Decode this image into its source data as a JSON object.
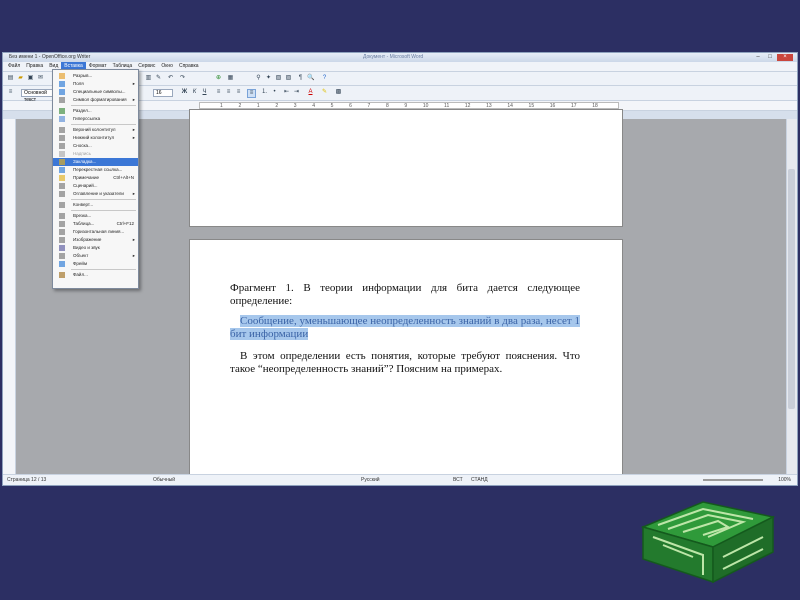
{
  "window": {
    "title": "Без имени 1 - OpenOffice.org Writer",
    "center_title": "Документ - Microsoft Word"
  },
  "menubar": [
    "Файл",
    "Правка",
    "Вид",
    "Вставка",
    "Формат",
    "Таблица",
    "Сервис",
    "Окно",
    "Справка"
  ],
  "format_bar": {
    "style_value": "Основной текст",
    "size_value": "16",
    "zoom_label": "100%"
  },
  "ruler": {
    "ticks": [
      "1",
      "2",
      "1",
      "2",
      "3",
      "4",
      "5",
      "6",
      "7",
      "8",
      "9",
      "10",
      "11",
      "12",
      "13",
      "14",
      "15",
      "16",
      "17",
      "18"
    ]
  },
  "insert_menu": {
    "items": [
      {
        "label": "Разрыв...",
        "type": "item"
      },
      {
        "label": "Поля",
        "type": "submenu"
      },
      {
        "label": "Специальные символы...",
        "type": "item"
      },
      {
        "label": "Символ форматирования",
        "type": "submenu"
      },
      {
        "type": "separator"
      },
      {
        "label": "Раздел...",
        "type": "item"
      },
      {
        "label": "Гиперссылка",
        "type": "item"
      },
      {
        "type": "separator"
      },
      {
        "label": "Верхний колонтитул",
        "type": "submenu"
      },
      {
        "label": "Нижний колонтитул",
        "type": "submenu"
      },
      {
        "label": "Сноска...",
        "type": "item"
      },
      {
        "label": "Надпись",
        "type": "disabled"
      },
      {
        "label": "Закладка...",
        "type": "selected"
      },
      {
        "label": "Перекрестная ссылка...",
        "type": "item"
      },
      {
        "label": "Примечание",
        "shortcut": "Ctrl+Alt+N",
        "type": "item"
      },
      {
        "label": "Сценарий...",
        "type": "item"
      },
      {
        "label": "Оглавление и указатели",
        "type": "submenu"
      },
      {
        "type": "separator"
      },
      {
        "label": "Конверт...",
        "type": "item"
      },
      {
        "type": "separator"
      },
      {
        "label": "Врезка...",
        "type": "item"
      },
      {
        "label": "Таблица...",
        "shortcut": "Ctrl+F12",
        "type": "item"
      },
      {
        "label": "Горизонтальная линия...",
        "type": "item"
      },
      {
        "label": "Изображение",
        "type": "submenu"
      },
      {
        "label": "Видео и звук",
        "type": "item"
      },
      {
        "label": "Объект",
        "type": "submenu"
      },
      {
        "label": "Фрейм",
        "type": "item"
      },
      {
        "type": "separator"
      },
      {
        "label": "Файл...",
        "type": "item"
      }
    ]
  },
  "document": {
    "para1": "Фрагмент 1. В теории информации для бита дается следующее определение:",
    "para2": "Сообщение, уменьшающее неопределенность знаний в два раза, несет 1 бит информации",
    "para3": "В этом определении есть понятия, которые требуют пояснения. Что такое “неопределенность знаний”? Поясним на примерах."
  },
  "statusbar": {
    "page": "Страница 12 / 13",
    "style": "Обычный",
    "language": "Русский",
    "ins": "ВСТ",
    "std": "СТАНД",
    "zoom": "100%"
  },
  "colors": {
    "background": "#2c2f63",
    "selection": "#3b77d6",
    "highlight": "#a6c7ec",
    "logo_green": "#2f9a3a"
  }
}
